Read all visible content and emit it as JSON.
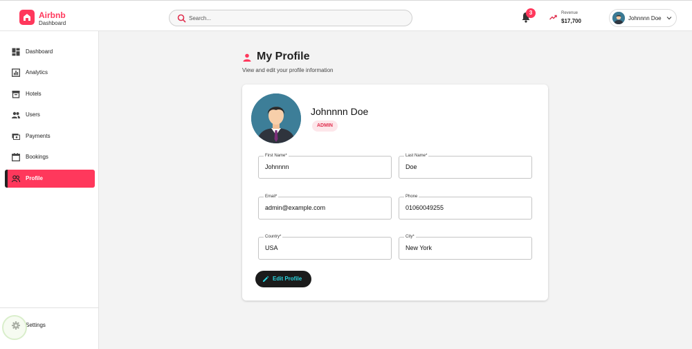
{
  "brand": {
    "name": "Airbnb",
    "subtitle": "Dashboard",
    "color": "#ff385c"
  },
  "search": {
    "placeholder": "Search..."
  },
  "notifications": {
    "count": "3"
  },
  "revenue": {
    "label": "Revenue",
    "value": "$17,700"
  },
  "user": {
    "name": "Johnnnn Doe"
  },
  "sidebar": {
    "items": [
      {
        "label": "Dashboard",
        "icon": "dashboard-icon"
      },
      {
        "label": "Analytics",
        "icon": "analytics-icon"
      },
      {
        "label": "Hotels",
        "icon": "hotel-icon"
      },
      {
        "label": "Users",
        "icon": "users-icon"
      },
      {
        "label": "Payments",
        "icon": "payments-icon"
      },
      {
        "label": "Bookings",
        "icon": "calendar-icon"
      },
      {
        "label": "Profile",
        "icon": "profile-icon",
        "active": true
      }
    ],
    "settings_label": "Settings"
  },
  "page": {
    "title": "My Profile",
    "subtitle": "View and edit your profile information"
  },
  "profile": {
    "name": "Johnnnn Doe",
    "role": "ADMIN",
    "fields": {
      "first_name": {
        "label": "First Name*",
        "value": "Johnnnn"
      },
      "last_name": {
        "label": "Last Name*",
        "value": "Doe"
      },
      "email": {
        "label": "Email*",
        "value": "admin@example.com"
      },
      "phone": {
        "label": "Phone",
        "value": "01060049255"
      },
      "country": {
        "label": "Country*",
        "value": "USA"
      },
      "city": {
        "label": "City*",
        "value": "New York"
      }
    },
    "edit_label": "Edit Profile"
  },
  "colors": {
    "accent": "#ff385c",
    "button": "#1b1b1b",
    "button_text": "#2ad6e0"
  }
}
